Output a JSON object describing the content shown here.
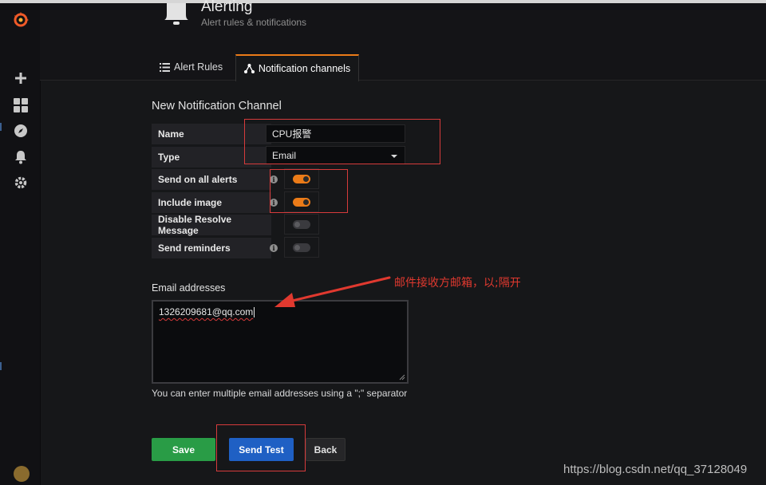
{
  "header": {
    "title": "Alerting",
    "subtitle": "Alert rules & notifications"
  },
  "tabs": [
    {
      "label": "Alert Rules"
    },
    {
      "label": "Notification channels"
    }
  ],
  "form": {
    "title": "New Notification Channel",
    "name_label": "Name",
    "name_value": "CPU报警",
    "type_label": "Type",
    "type_value": "Email",
    "send_all_label": "Send on all alerts",
    "send_all_on": true,
    "include_image_label": "Include image",
    "include_image_on": true,
    "disable_resolve_label": "Disable Resolve Message",
    "disable_resolve_on": false,
    "reminders_label": "Send reminders",
    "reminders_on": false,
    "info_glyph": "i",
    "email_label": "Email addresses",
    "email_value": "1326209681@qq.com",
    "email_hint": "You can enter multiple email addresses using a \";\" separator"
  },
  "annotation": {
    "text": "邮件接收方邮箱，以;隔开",
    "color": "#e0392f"
  },
  "buttons": {
    "save": "Save",
    "send_test": "Send Test",
    "back": "Back"
  },
  "watermark": "https://blog.csdn.net/qq_37128049",
  "colors": {
    "accent": "#eb7b18",
    "save": "#299c46",
    "primary": "#1f60c4",
    "highlight_box": "#d63b3b"
  },
  "sidebar_icons": [
    "grafana-logo-icon",
    "plus-icon",
    "dashboards-icon",
    "explore-icon",
    "bell-icon",
    "gear-icon",
    "avatar"
  ]
}
